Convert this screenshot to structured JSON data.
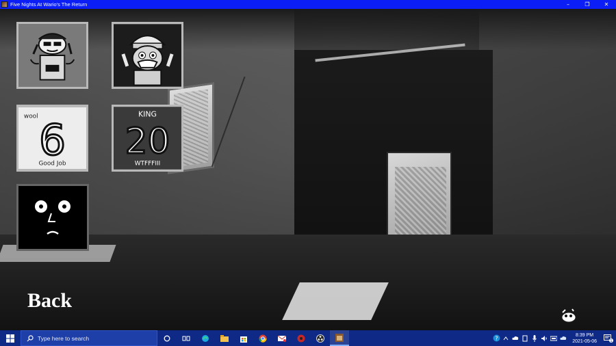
{
  "window": {
    "title": "Five Nights At Wario's The Return",
    "controls": {
      "minimize": "–",
      "restore": "❐",
      "close": "✕"
    }
  },
  "game": {
    "back_label": "Back",
    "tiles": [
      {
        "name": "character-tile-1"
      },
      {
        "name": "character-tile-2"
      },
      {
        "name": "character-tile-3",
        "top_text": "wool",
        "number": "6",
        "bottom_text": "Good Job"
      },
      {
        "name": "character-tile-4",
        "top_text": "KING",
        "number": "20",
        "bottom_text": "WTFFFIII"
      },
      {
        "name": "character-tile-5"
      }
    ]
  },
  "taskbar": {
    "search_placeholder": "Type here to search",
    "clock_time": "8:39 PM",
    "clock_date": "2021-05-06",
    "notification_count": "1"
  },
  "colors": {
    "titlebar": "#0a1ef5",
    "taskbar": "#0f2a86",
    "back_text": "#ffffff"
  }
}
